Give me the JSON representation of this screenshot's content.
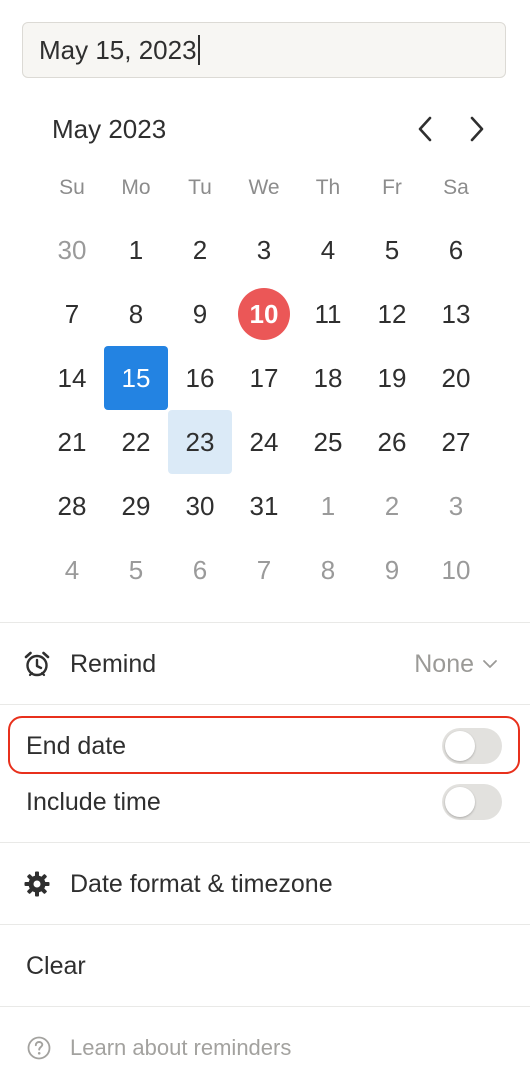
{
  "date_input": {
    "value": "May 15, 2023"
  },
  "calendar": {
    "month_label": "May 2023",
    "weekdays": [
      "Su",
      "Mo",
      "Tu",
      "We",
      "Th",
      "Fr",
      "Sa"
    ],
    "weeks": [
      [
        "30",
        "1",
        "2",
        "3",
        "4",
        "5",
        "6"
      ],
      [
        "7",
        "8",
        "9",
        "10",
        "11",
        "12",
        "13"
      ],
      [
        "14",
        "15",
        "16",
        "17",
        "18",
        "19",
        "20"
      ],
      [
        "21",
        "22",
        "23",
        "24",
        "25",
        "26",
        "27"
      ],
      [
        "28",
        "29",
        "30",
        "31",
        "1",
        "2",
        "3"
      ],
      [
        "4",
        "5",
        "6",
        "7",
        "8",
        "9",
        "10"
      ]
    ]
  },
  "remind": {
    "label": "Remind",
    "value": "None"
  },
  "end_date": {
    "label": "End date",
    "enabled": false
  },
  "include_time": {
    "label": "Include time",
    "enabled": false
  },
  "date_format": {
    "label": "Date format & timezone"
  },
  "clear": {
    "label": "Clear"
  },
  "footer": {
    "help_label": "Learn about reminders"
  },
  "colors": {
    "selected": "#2383e2",
    "today": "#eb5757",
    "hover": "#dbeaf7",
    "highlight_outline": "#e8301c"
  }
}
